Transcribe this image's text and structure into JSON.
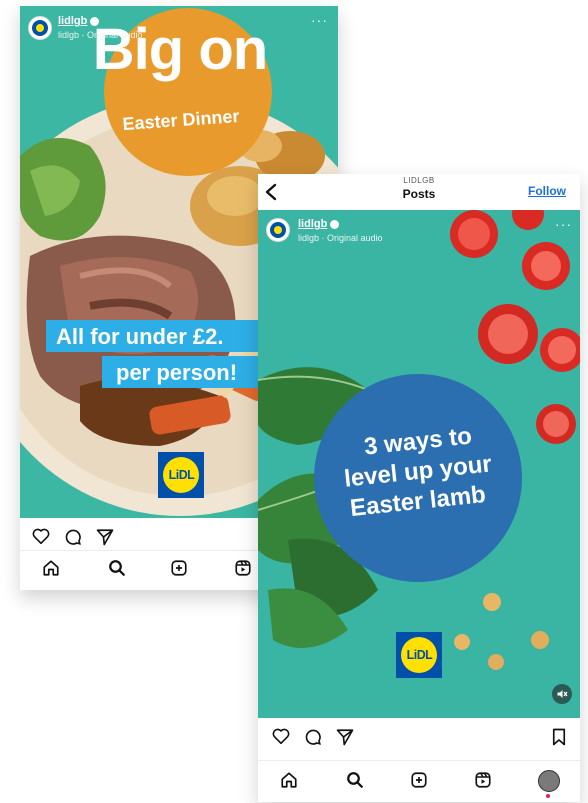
{
  "post1": {
    "account": {
      "name": "lidlgb",
      "audio": "lidlgb · Original audio"
    },
    "overlay": {
      "headline": "Big on",
      "badge_sub": "Easter Dinner",
      "banner_line1": "All for under £2.",
      "banner_line2": "per person!"
    },
    "logo_text": "LiDL"
  },
  "post2": {
    "header": {
      "eyebrow": "LIDLGB",
      "title": "Posts",
      "follow": "Follow"
    },
    "account": {
      "name": "lidlgb",
      "audio": "lidlgb · Original audio"
    },
    "overlay": {
      "line1": "3 ways to",
      "line2": "level up your",
      "line3": "Easter lamb"
    },
    "logo_text": "LiDL"
  },
  "colors": {
    "teal": "#3ab4a3",
    "orange": "#e99a2c",
    "sky": "#2eaee6",
    "blue_circle": "#2b6fb0",
    "link": "#1e6fd9"
  },
  "icons": [
    "heart-icon",
    "comment-icon",
    "share-icon",
    "bookmark-icon",
    "home-icon",
    "search-icon",
    "create-icon",
    "reels-icon",
    "profile-icon",
    "mute-icon",
    "back-icon",
    "more-icon"
  ]
}
